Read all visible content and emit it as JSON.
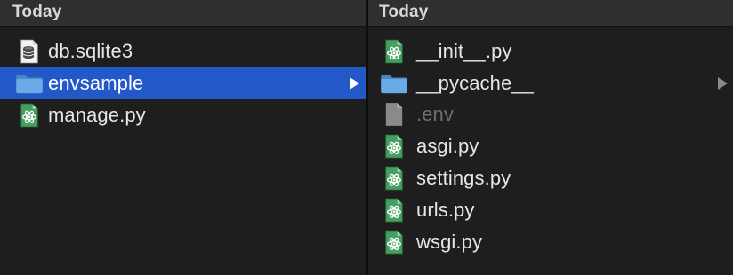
{
  "window": {
    "view": "column"
  },
  "columns": [
    {
      "header": "Today",
      "items": [
        {
          "name": "db.sqlite3",
          "icon": "sqlite-database-icon",
          "kind": "file",
          "selected": false
        },
        {
          "name": "envsample",
          "icon": "folder-icon",
          "kind": "folder",
          "selected": true
        },
        {
          "name": "manage.py",
          "icon": "python-atom-file-icon",
          "kind": "file",
          "selected": false
        }
      ]
    },
    {
      "header": "Today",
      "items": [
        {
          "name": "__init__.py",
          "icon": "python-atom-file-icon",
          "kind": "file"
        },
        {
          "name": "__pycache__",
          "icon": "folder-icon",
          "kind": "folder"
        },
        {
          "name": ".env",
          "icon": "generic-file-icon",
          "kind": "hidden-file"
        },
        {
          "name": "asgi.py",
          "icon": "python-atom-file-icon",
          "kind": "file"
        },
        {
          "name": "settings.py",
          "icon": "python-atom-file-icon",
          "kind": "file"
        },
        {
          "name": "urls.py",
          "icon": "python-atom-file-icon",
          "kind": "file"
        },
        {
          "name": "wsgi.py",
          "icon": "python-atom-file-icon",
          "kind": "file"
        }
      ]
    }
  ],
  "colors": {
    "background": "#1e1e1e",
    "header_background": "#2f2f2f",
    "selection": "#2358c9",
    "text": "#e6e6e6",
    "dimmed_text": "#6e6e6e",
    "folder": "#5b9bd8",
    "python_icon_green": "#3e9a5a"
  }
}
